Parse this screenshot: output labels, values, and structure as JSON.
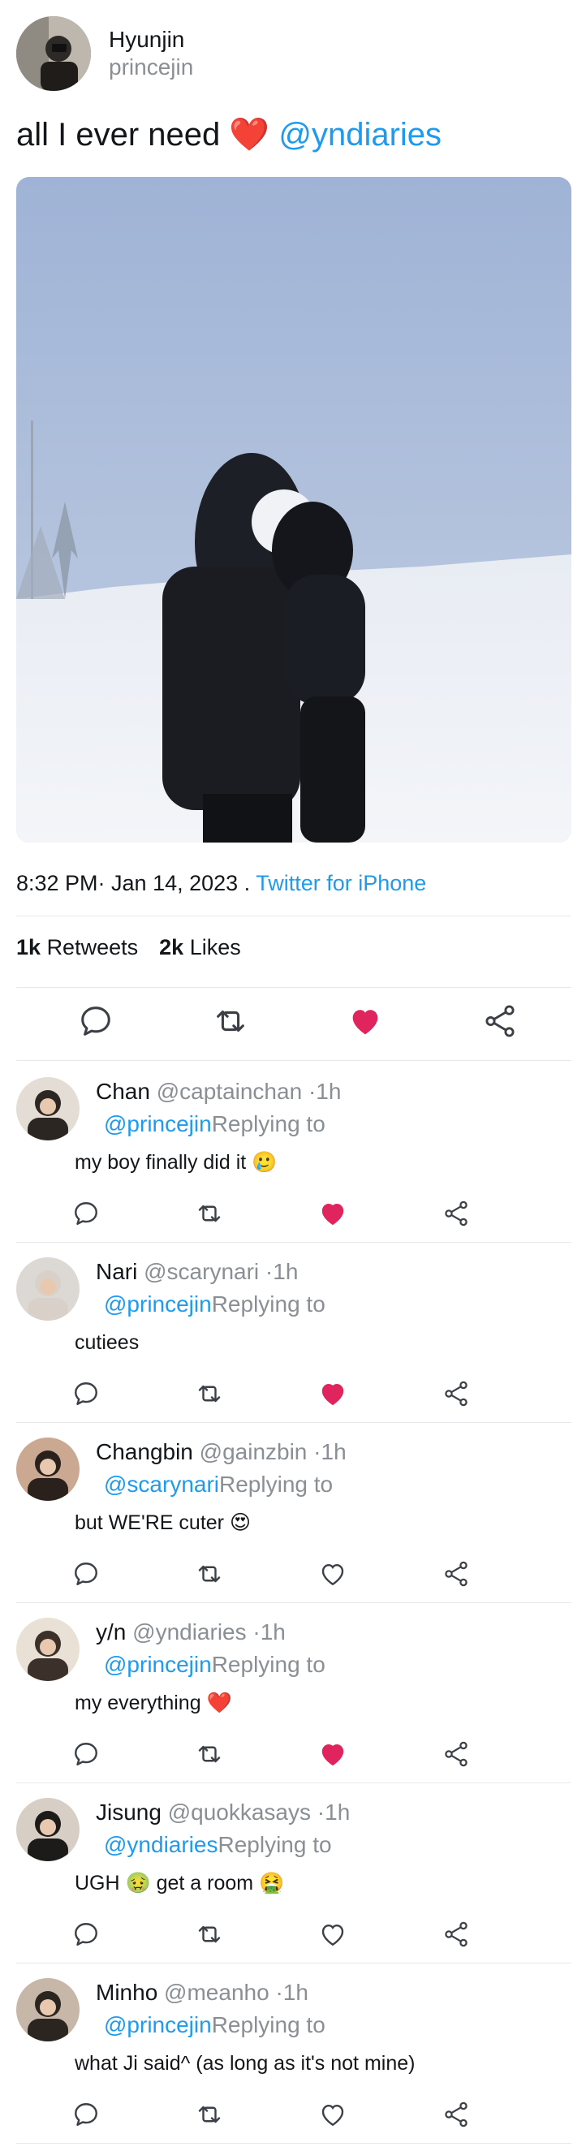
{
  "author": {
    "display_name": "Hyunjin",
    "handle": "princejin",
    "avatar_icon": "avatar-photo"
  },
  "tweet": {
    "text": "all I ever need",
    "emoji": "❤️",
    "mention": "@yndiaries",
    "photo_icon": "snow-hug-photo",
    "timestamp": "8:32 PM· Jan 14, 2023 .",
    "source": "Twitter for iPhone"
  },
  "stats": {
    "retweets_count": "1k",
    "retweets_label": "Retweets",
    "likes_count": "2k",
    "likes_label": "Likes"
  },
  "actions": {
    "reply_icon": "reply-icon",
    "retweet_icon": "retweet-icon",
    "like_icon": "heart-icon",
    "share_icon": "share-icon"
  },
  "colors": {
    "accent": "#1d9bf0",
    "like": "#e0245e",
    "muted": "#8a8f94"
  },
  "replies": [
    {
      "name": "Chan",
      "handle": "@captainchan",
      "time": "·1h",
      "mention": "@princejin",
      "replying": "Replying to",
      "text": "my boy finally did it 🥲",
      "liked": true
    },
    {
      "name": "Nari",
      "handle": "@scarynari",
      "time": "·1h",
      "mention": "@princejin",
      "replying": "Replying to",
      "text": "cutiees",
      "liked": true
    },
    {
      "name": "Changbin",
      "handle": "@gainzbin",
      "time": "·1h",
      "mention": "@scarynari",
      "replying": "Replying to",
      "text": "but WE'RE cuter 😍",
      "liked": false
    },
    {
      "name": "y/n",
      "handle": "@yndiaries",
      "time": "·1h",
      "mention": "@princejin",
      "replying": "Replying to",
      "text": "my everything ❤️",
      "liked": true
    },
    {
      "name": "Jisung",
      "handle": "@quokkasays",
      "time": "·1h",
      "mention": "@yndiaries",
      "replying": "Replying to",
      "text": "UGH 🤢 get a room 🤮",
      "liked": false
    },
    {
      "name": "Minho",
      "handle": "@meanho",
      "time": "·1h",
      "mention": "@princejin",
      "replying": "Replying to",
      "text": "what Ji said^ (as long as it's not mine)",
      "liked": false
    }
  ]
}
